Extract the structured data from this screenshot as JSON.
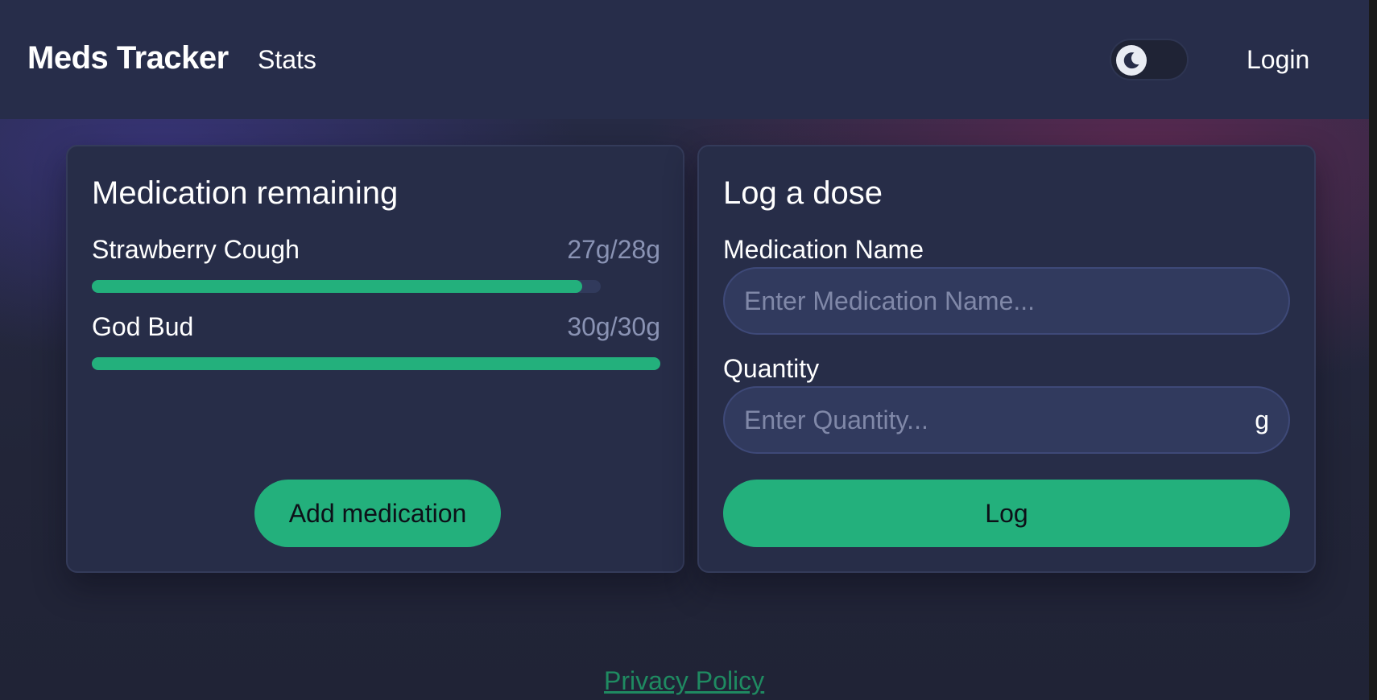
{
  "header": {
    "brand": "Meds Tracker",
    "nav_stats": "Stats",
    "theme_toggle_icon": "moon-icon",
    "login": "Login"
  },
  "remaining": {
    "title": "Medication remaining",
    "items": [
      {
        "name": "Strawberry Cough",
        "amount": "27g/28g",
        "remaining": 27,
        "total": 28
      },
      {
        "name": "God Bud",
        "amount": "30g/30g",
        "remaining": 30,
        "total": 30
      }
    ],
    "add_button": "Add medication"
  },
  "log": {
    "title": "Log a dose",
    "name_label": "Medication Name",
    "name_placeholder": "Enter Medication Name...",
    "qty_label": "Quantity",
    "qty_placeholder": "Enter Quantity...",
    "qty_unit": "g",
    "log_button": "Log"
  },
  "footer": {
    "privacy": "Privacy Policy"
  },
  "colors": {
    "accent": "#23b07c",
    "background": "#222538",
    "card": "#272d48"
  }
}
